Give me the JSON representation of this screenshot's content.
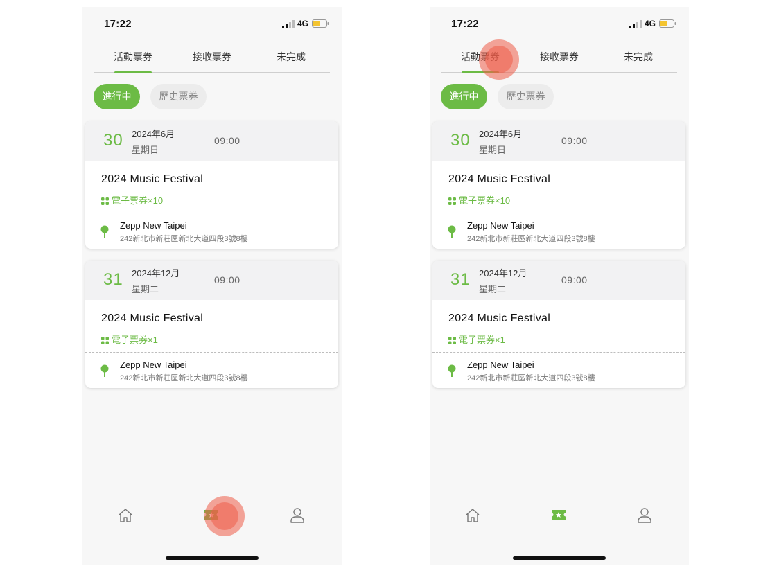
{
  "screens": [
    {
      "status": {
        "time": "17:22",
        "network": "4G"
      },
      "tabs": [
        {
          "label": "活動票券"
        },
        {
          "label": "接收票券"
        },
        {
          "label": "未完成"
        }
      ],
      "filters": {
        "active": "進行中",
        "inactive": "歷史票券"
      },
      "events": [
        {
          "day": "30",
          "month": "2024年6月",
          "weekday": "星期日",
          "time": "09:00",
          "title": "2024 Music Festival",
          "tickets": "電子票券×10",
          "venue": "Zepp New Taipei",
          "address": "242新北市新莊區新北大道四段3號8樓"
        },
        {
          "day": "31",
          "month": "2024年12月",
          "weekday": "星期二",
          "time": "09:00",
          "title": "2024 Music Festival",
          "tickets": "電子票券×1",
          "venue": "Zepp New Taipei",
          "address": "242新北市新莊區新北大道四段3號8樓"
        }
      ],
      "nav": {
        "home_icon": "home-icon",
        "ticket_icon": "ticket-icon",
        "user_icon": "user-icon"
      }
    },
    {
      "status": {
        "time": "17:22",
        "network": "4G"
      },
      "tabs": [
        {
          "label": "活動票券"
        },
        {
          "label": "接收票券"
        },
        {
          "label": "未完成"
        }
      ],
      "filters": {
        "active": "進行中",
        "inactive": "歷史票券"
      },
      "events": [
        {
          "day": "30",
          "month": "2024年6月",
          "weekday": "星期日",
          "time": "09:00",
          "title": "2024 Music Festival",
          "tickets": "電子票券×10",
          "venue": "Zepp New Taipei",
          "address": "242新北市新莊區新北大道四段3號8樓"
        },
        {
          "day": "31",
          "month": "2024年12月",
          "weekday": "星期二",
          "time": "09:00",
          "title": "2024 Music Festival",
          "tickets": "電子票券×1",
          "venue": "Zepp New Taipei",
          "address": "242新北市新莊區新北大道四段3號8樓"
        }
      ],
      "nav": {
        "home_icon": "home-icon",
        "ticket_icon": "ticket-icon",
        "user_icon": "user-icon"
      }
    }
  ],
  "colors": {
    "accent": "#6cbb45",
    "touch": "#ee5c48",
    "background": "#f7f7f7"
  }
}
